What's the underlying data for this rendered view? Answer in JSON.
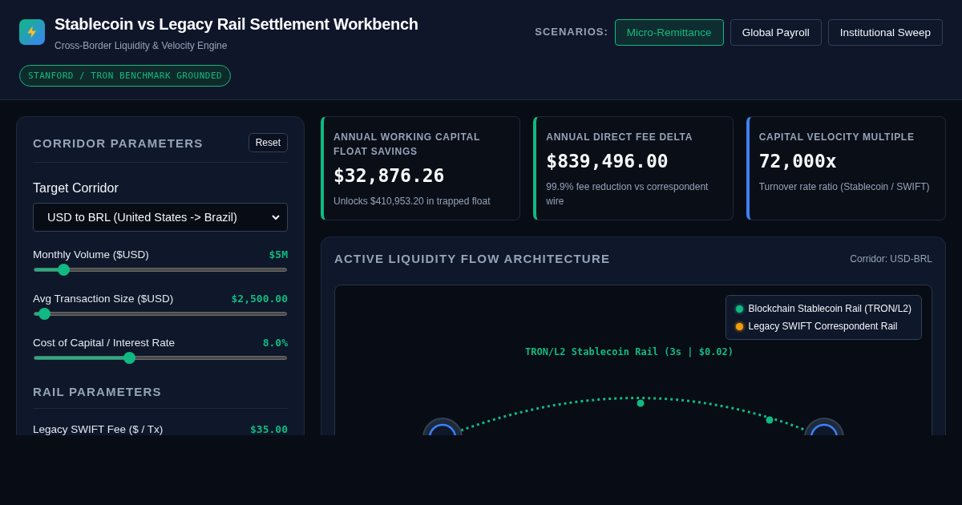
{
  "header": {
    "title": "Stablecoin vs Legacy Rail Settlement Workbench",
    "subtitle": "Cross-Border Liquidity & Velocity Engine",
    "badge": "STANFORD / TRON BENCHMARK GROUNDED",
    "scenarios_label": "SCENARIOS:",
    "scenarios": [
      {
        "label": "Micro-Remittance",
        "selected": true
      },
      {
        "label": "Global Payroll",
        "selected": false
      },
      {
        "label": "Institutional Sweep",
        "selected": false
      }
    ]
  },
  "corridor_panel": {
    "title": "CORRIDOR PARAMETERS",
    "reset": "Reset",
    "corridor_label": "Target Corridor",
    "corridor_value": "USD to BRL (United States -> Brazil)",
    "sliders": [
      {
        "label": "Monthly Volume ($USD)",
        "reading": "$5M",
        "level": 0.1
      },
      {
        "label": "Avg Transaction Size ($USD)",
        "reading": "$2,500.00",
        "level": 0.02
      },
      {
        "label": "Cost of Capital / Interest Rate",
        "reading": "8.0%",
        "level": 0.37
      }
    ],
    "rail_title": "RAIL PARAMETERS",
    "rail_rows": [
      {
        "label": "Legacy SWIFT Fee ($ / Tx)",
        "reading": "$35.00"
      }
    ]
  },
  "metrics": [
    {
      "title": "ANNUAL WORKING CAPITAL FLOAT SAVINGS",
      "value": "$32,876.26",
      "note": "Unlocks $410,953.20 in trapped float",
      "color": "#10b981"
    },
    {
      "title": "ANNUAL DIRECT FEE DELTA",
      "value": "$839,496.00",
      "note": "99.9% fee reduction vs correspondent wire",
      "color": "#10b981"
    },
    {
      "title": "CAPITAL VELOCITY MULTIPLE",
      "value": "72,000x",
      "note": "Turnover rate ratio (Stablecoin / SWIFT)",
      "color": "#3b82f6"
    }
  ],
  "flow_panel": {
    "title": "ACTIVE LIQUIDITY FLOW ARCHITECTURE",
    "corridor": "Corridor: USD-BRL",
    "legend": [
      {
        "label": "Blockchain Stablecoin Rail (TRON/L2)",
        "color": "#10b981"
      },
      {
        "label": "Legacy SWIFT Correspondent Rail",
        "color": "#f59e0b"
      }
    ],
    "rail_label": "TRON/L2 Stablecoin Rail (3s | $0.02)"
  }
}
